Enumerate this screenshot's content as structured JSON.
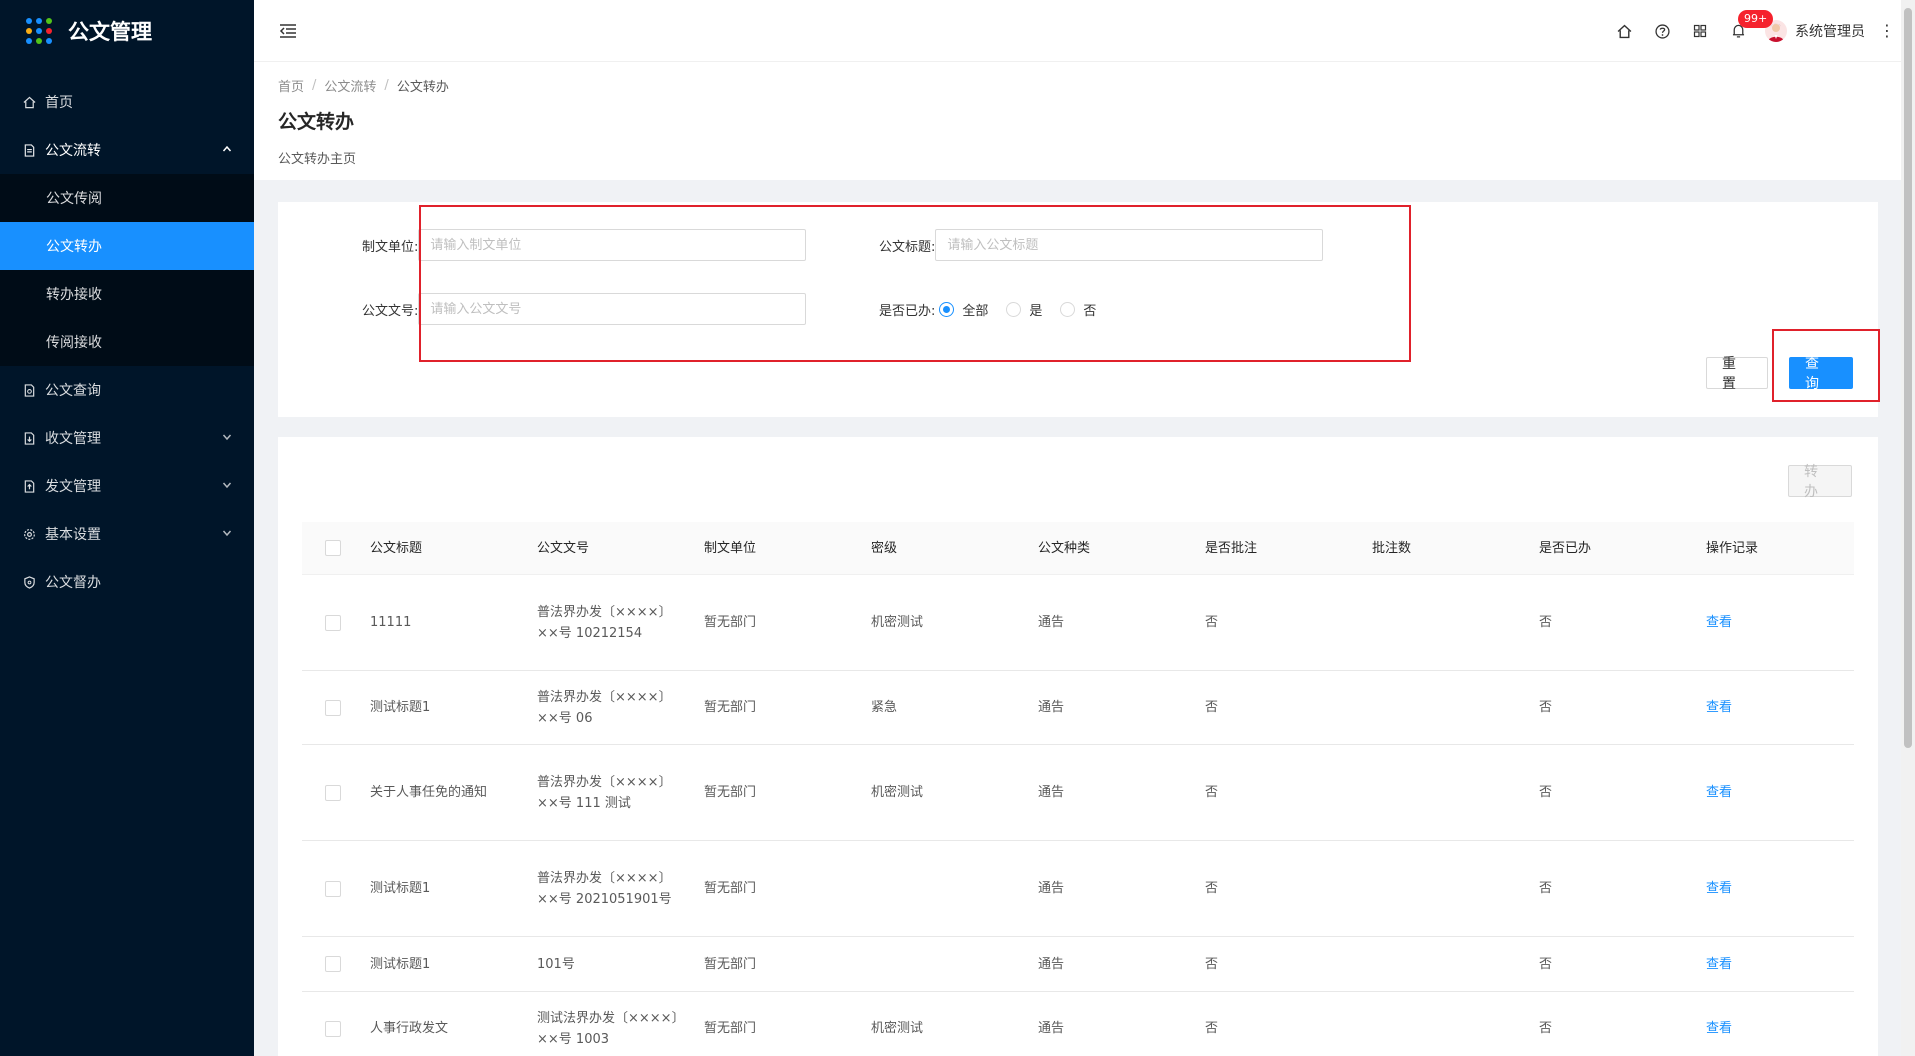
{
  "app": {
    "title": "公文管理",
    "logo_dot_colors": [
      "#1890ff",
      "#1890ff",
      "#52c41a",
      "#faad14",
      "#1890ff",
      "#f5222d",
      "#1890ff",
      "#52c41a",
      "#1890ff"
    ]
  },
  "sidebar": {
    "items": [
      {
        "label": "首页",
        "icon": "home-icon"
      },
      {
        "label": "公文流转",
        "icon": "document-icon",
        "arrow": "⌃"
      },
      {
        "label": "公文查询",
        "icon": "document-search-icon"
      },
      {
        "label": "收文管理",
        "icon": "inbox-file-icon",
        "arrow": "⌄"
      },
      {
        "label": "发文管理",
        "icon": "outbox-file-icon",
        "arrow": "⌄"
      },
      {
        "label": "基本设置",
        "icon": "gear-icon",
        "arrow": "⌄"
      },
      {
        "label": "公文督办",
        "icon": "shield-icon"
      }
    ],
    "submenu": [
      {
        "label": "公文传阅"
      },
      {
        "label": "公文转办"
      },
      {
        "label": "转办接收"
      },
      {
        "label": "传阅接收"
      }
    ]
  },
  "header": {
    "notification_count": "99+",
    "username": "系统管理员",
    "more": "⋮"
  },
  "page": {
    "breadcrumb": [
      "首页",
      "公文流转",
      "公文转办"
    ],
    "breadcrumb_sep": "/",
    "title": "公文转办",
    "description": "公文转办主页"
  },
  "search": {
    "unit_label": "制文单位:",
    "unit_placeholder": "请输入制文单位",
    "title_label": "公文标题:",
    "title_placeholder": "请输入公文标题",
    "docno_label": "公文文号:",
    "docno_placeholder": "请输入公文文号",
    "done_label": "是否已办:",
    "done_options": [
      "全部",
      "是",
      "否"
    ],
    "done_selected": "全部",
    "reset_button": "重置",
    "query_button": "查询"
  },
  "table": {
    "transfer_button": "转办",
    "columns": [
      "公文标题",
      "公文文号",
      "制文单位",
      "密级",
      "公文种类",
      "是否批注",
      "批注数",
      "是否已办",
      "操作记录"
    ],
    "rows": [
      {
        "title": "11111",
        "docno": "普法界办发〔××××〕××号 10212154",
        "unit": "暂无部门",
        "level": "机密测试",
        "type": "通告",
        "annotated": "否",
        "count": "",
        "done": "否",
        "op": "查看"
      },
      {
        "title": "测试标题1",
        "docno": "普法界办发〔××××〕××号 06",
        "unit": "暂无部门",
        "level": "紧急",
        "type": "通告",
        "annotated": "否",
        "count": "",
        "done": "否",
        "op": "查看"
      },
      {
        "title": "关于人事任免的通知",
        "docno": "普法界办发〔××××〕××号 111 测试",
        "unit": "暂无部门",
        "level": "机密测试",
        "type": "通告",
        "annotated": "否",
        "count": "",
        "done": "否",
        "op": "查看"
      },
      {
        "title": "测试标题1",
        "docno": "普法界办发〔××××〕××号 2021051901号",
        "unit": "暂无部门",
        "level": "",
        "type": "通告",
        "annotated": "否",
        "count": "",
        "done": "否",
        "op": "查看"
      },
      {
        "title": "测试标题1",
        "docno": "101号",
        "unit": "暂无部门",
        "level": "",
        "type": "通告",
        "annotated": "否",
        "count": "",
        "done": "否",
        "op": "查看"
      },
      {
        "title": "人事行政发文",
        "docno": "测试法界办发〔××××〕××号 1003",
        "unit": "暂无部门",
        "level": "机密测试",
        "type": "通告",
        "annotated": "否",
        "count": "",
        "done": "否",
        "op": "查看"
      }
    ]
  },
  "colors": {
    "sidebar_bg": "#001529",
    "submenu_bg": "#000c17",
    "primary": "#1890ff",
    "highlight": "#e0212b",
    "badge": "#f5222d"
  }
}
